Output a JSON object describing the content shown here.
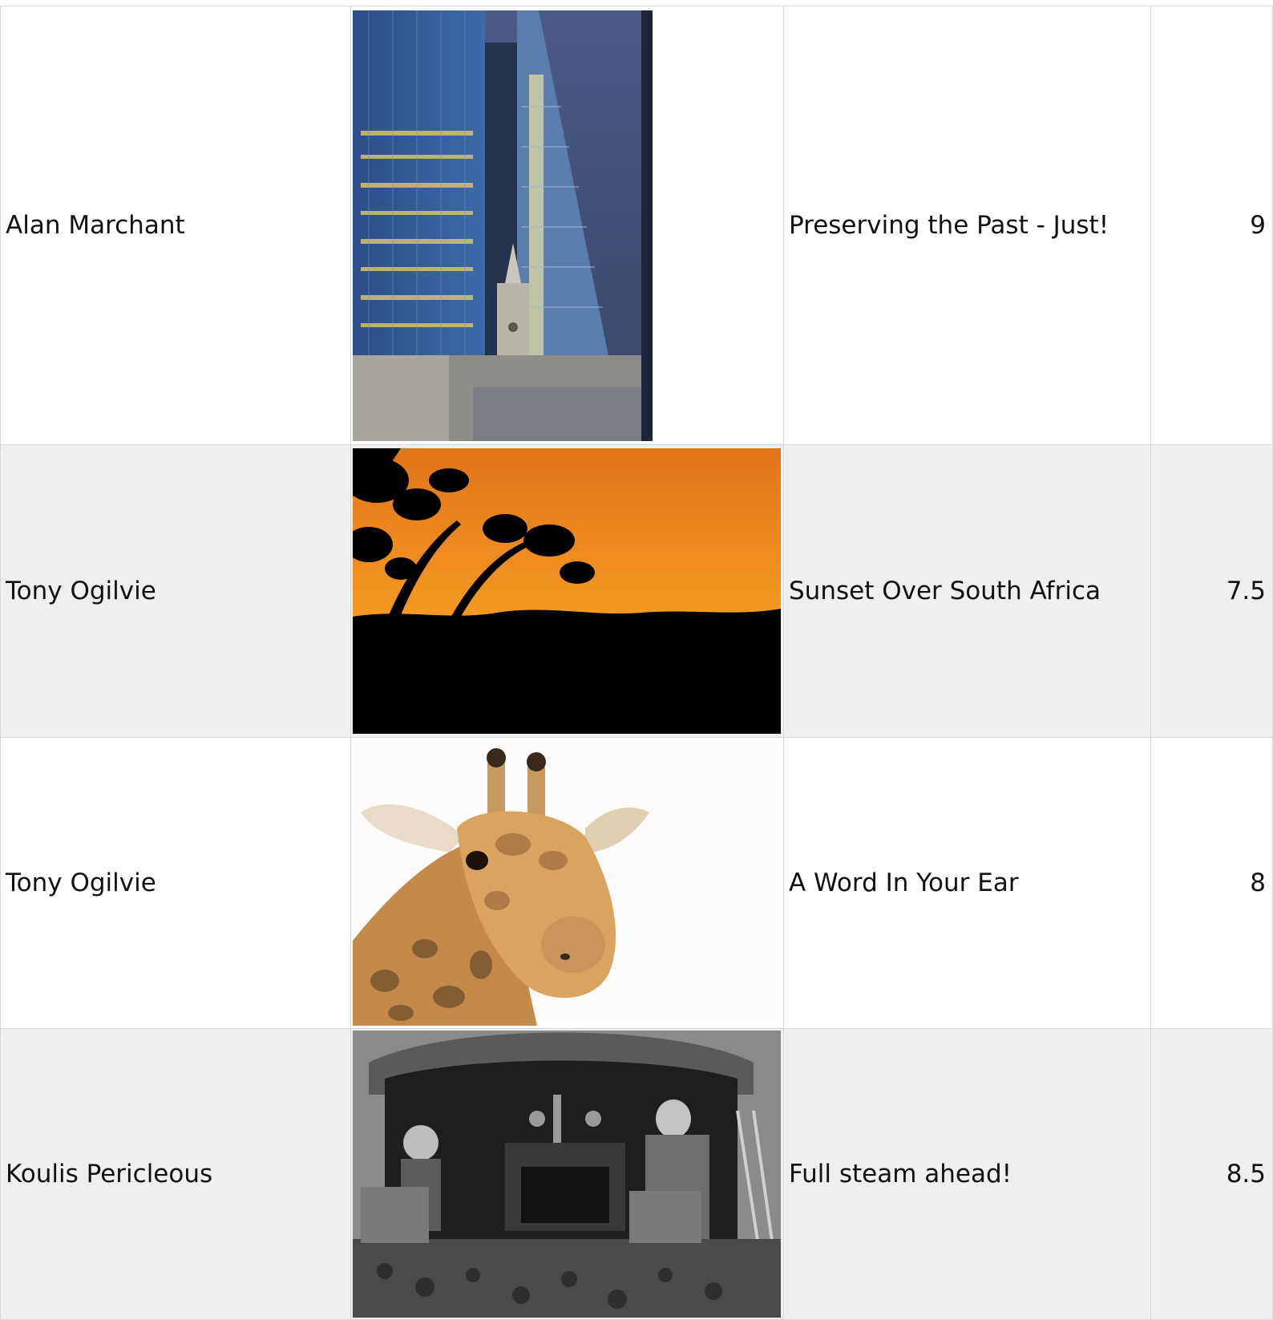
{
  "entries": [
    {
      "author": "Alan Marchant",
      "title": "Preserving the Past - Just!",
      "score": "9",
      "image": "city-towers-photo"
    },
    {
      "author": "Tony Ogilvie",
      "title": "Sunset Over South Africa",
      "score": "7.5",
      "image": "sunset-savanna-photo"
    },
    {
      "author": "Tony Ogilvie",
      "title": "A Word In Your Ear",
      "score": "8",
      "image": "giraffe-head-photo"
    },
    {
      "author": "Koulis Pericleous",
      "title": "Full steam ahead!",
      "score": "8.5",
      "image": "steam-locomotive-cab-photo"
    }
  ],
  "colors": {
    "row_alt": "#efefef",
    "border": "#d8d8d8",
    "sunset": "#f28a1a"
  }
}
